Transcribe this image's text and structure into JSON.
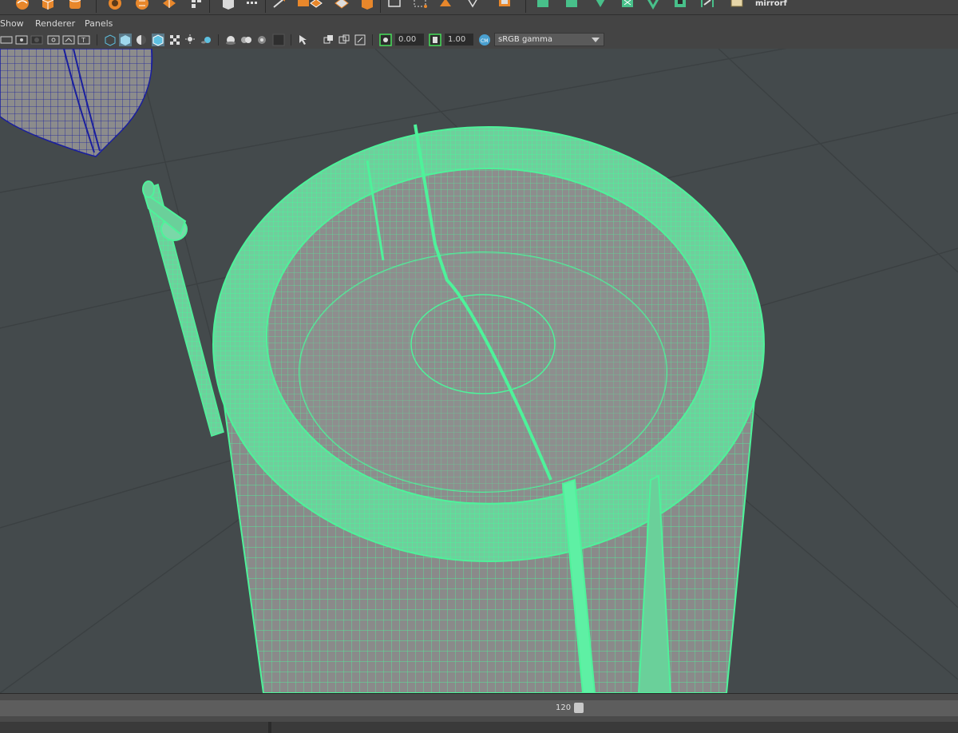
{
  "shelf": {
    "tail_label": "mirrorf",
    "icons": [
      "poly-sphere-icon",
      "poly-cube-icon",
      "poly-cylinder-icon",
      "poly-cone-icon",
      "soccer-ball-icon",
      "torus-icon",
      "cube-unfold-icon",
      "plane-icon",
      "sphere-outline-icon",
      "combine-icon",
      "separate-icon",
      "bevel-icon",
      "boolean-icon",
      "extrude-icon",
      "bridge-icon",
      "fill-hole-icon",
      "multi-cut-icon",
      "target-weld-icon",
      "merge-icon",
      "quad-draw-icon",
      "uv-layout-icon",
      "uv-editor-icon",
      "smooth-icon",
      "reduce-icon",
      "mirror-icon",
      "mirror-script-icon"
    ]
  },
  "panel_menu": {
    "show": "Show",
    "renderer": "Renderer",
    "panels": "Panels"
  },
  "toolbar": {
    "exposure": "0.00",
    "gamma": "1.00",
    "color_space": "sRGB gamma"
  },
  "colors": {
    "selection_green": "#4ef29a",
    "unselected_wire": "#1a1f9e",
    "mesh_gray": "#8a8a8a",
    "viewport_bg": "#444a4c",
    "shelf_orange": "#e8872b"
  },
  "timeline": {
    "current_frame": "120"
  }
}
